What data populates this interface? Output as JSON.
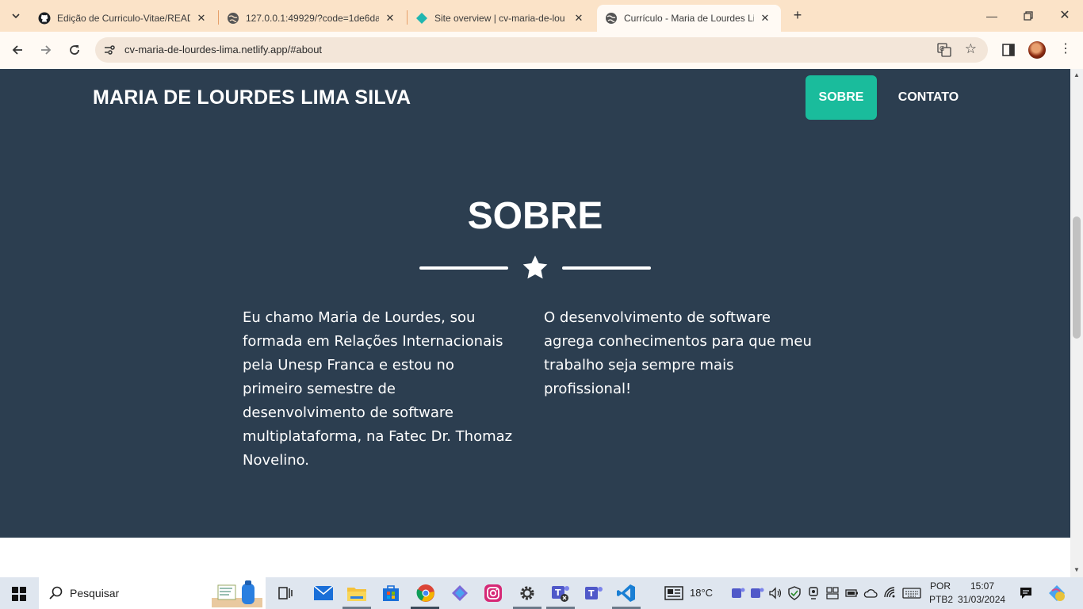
{
  "browser": {
    "tabs": [
      {
        "title": "Edição de Curriculo-Vitae/READ",
        "icon": "github-icon",
        "active": false
      },
      {
        "title": "127.0.0.1:49929/?code=1de6da",
        "icon": "globe-icon",
        "active": false
      },
      {
        "title": "Site overview | cv-maria-de-lou",
        "icon": "netlify-icon",
        "active": false
      },
      {
        "title": "Currículo - Maria de Lourdes Lin",
        "icon": "globe-icon",
        "active": true
      }
    ],
    "url": "cv-maria-de-lourdes-lima.netlify.app/#about"
  },
  "site": {
    "brand": "MARIA DE LOURDES LIMA SILVA",
    "nav": {
      "sobre": "SOBRE",
      "contato": "CONTATO"
    },
    "section_title": "SOBRE",
    "about_left": "Eu chamo Maria de Lourdes, sou formada em Relações Internacionais pela Unesp Franca e estou no primeiro semestre de desenvolvimento de software multiplataforma, na Fatec Dr. Thomaz Novelino.",
    "about_right": "O desenvolvimento de software agrega conhecimentos para que meu trabalho seja sempre mais profissional!",
    "colors": {
      "background": "#2c3e50",
      "accent": "#1abc9c"
    }
  },
  "taskbar": {
    "search_placeholder": "Pesquisar",
    "weather": "18°C",
    "language": "POR",
    "keyboard": "PTB2",
    "time": "15:07",
    "date": "31/03/2024"
  }
}
